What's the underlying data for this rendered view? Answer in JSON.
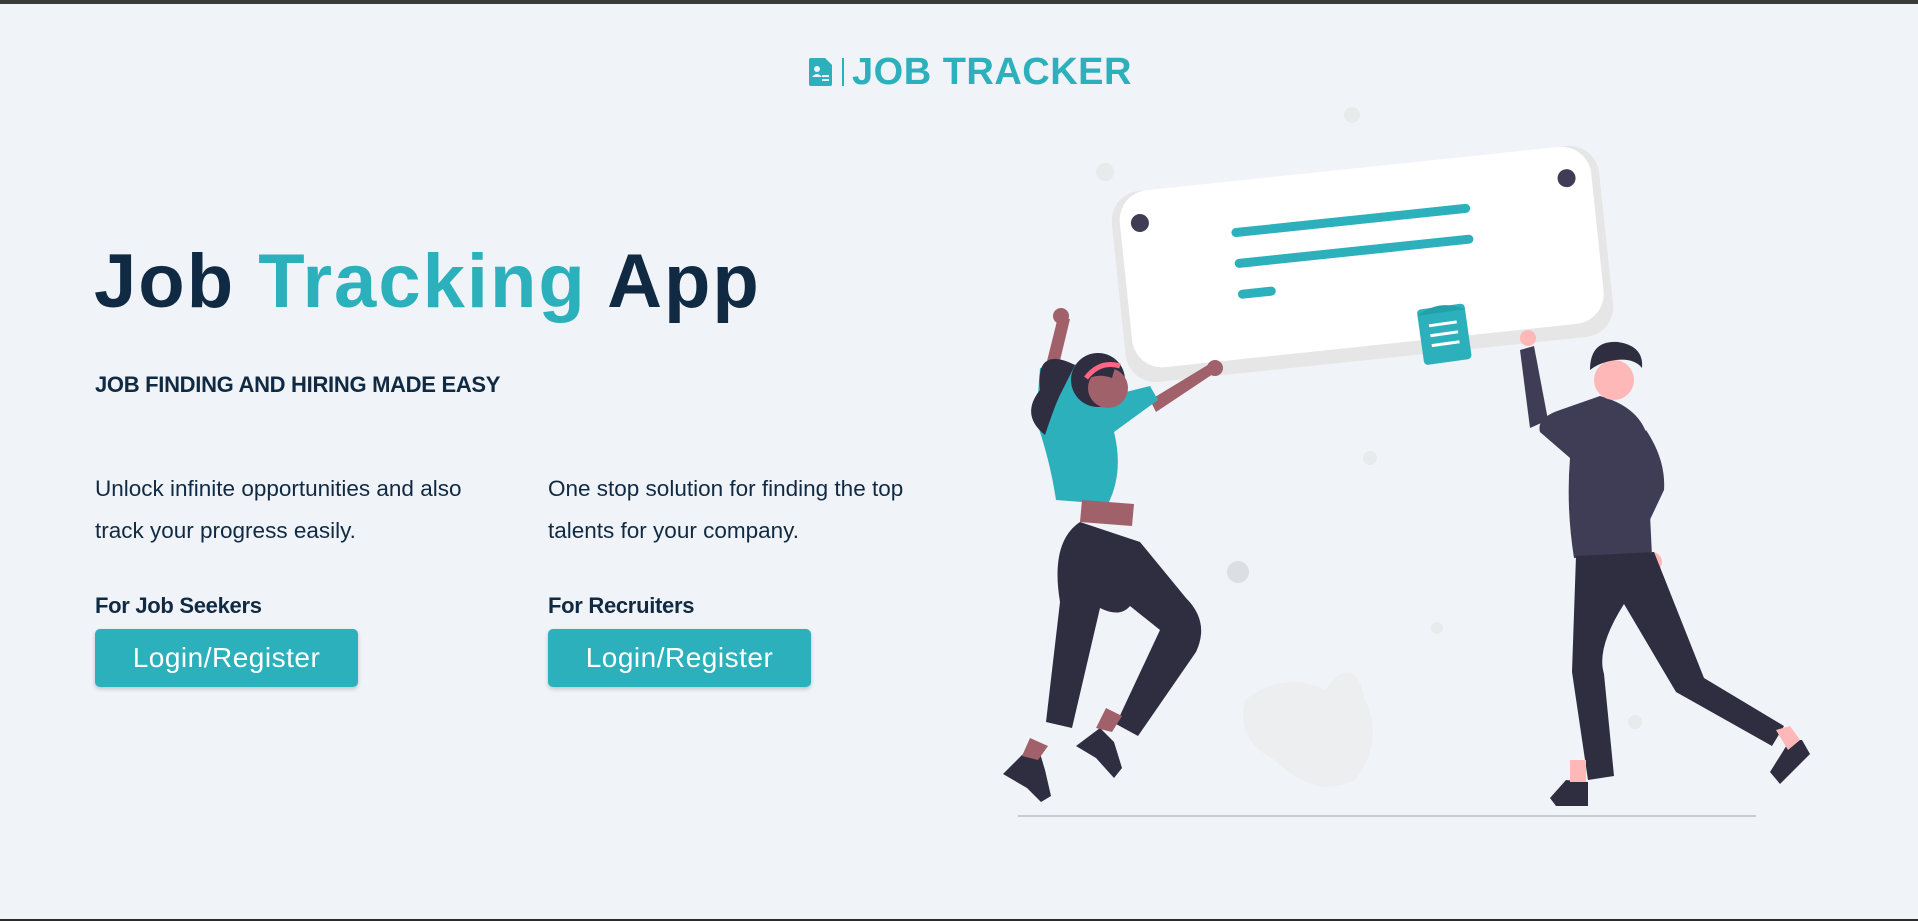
{
  "brand": {
    "name": "JOB TRACKER",
    "icon": "document-icon",
    "color": "#2cb1bc"
  },
  "hero": {
    "title_part1": "Job",
    "title_accent": "Tracking",
    "title_part2": "App",
    "tagline": "JOB FINDING AND HIRING MADE EASY"
  },
  "seekers": {
    "description": "Unlock infinite opportunities and also track your progress easily.",
    "heading": "For Job Seekers",
    "button_label": "Login/Register"
  },
  "recruiters": {
    "description": "One stop solution for finding the top talents for your company.",
    "heading": "For Recruiters",
    "button_label": "Login/Register"
  },
  "colors": {
    "primary": "#2cb1bc",
    "dark": "#102a43",
    "background": "#f0f3f7"
  }
}
